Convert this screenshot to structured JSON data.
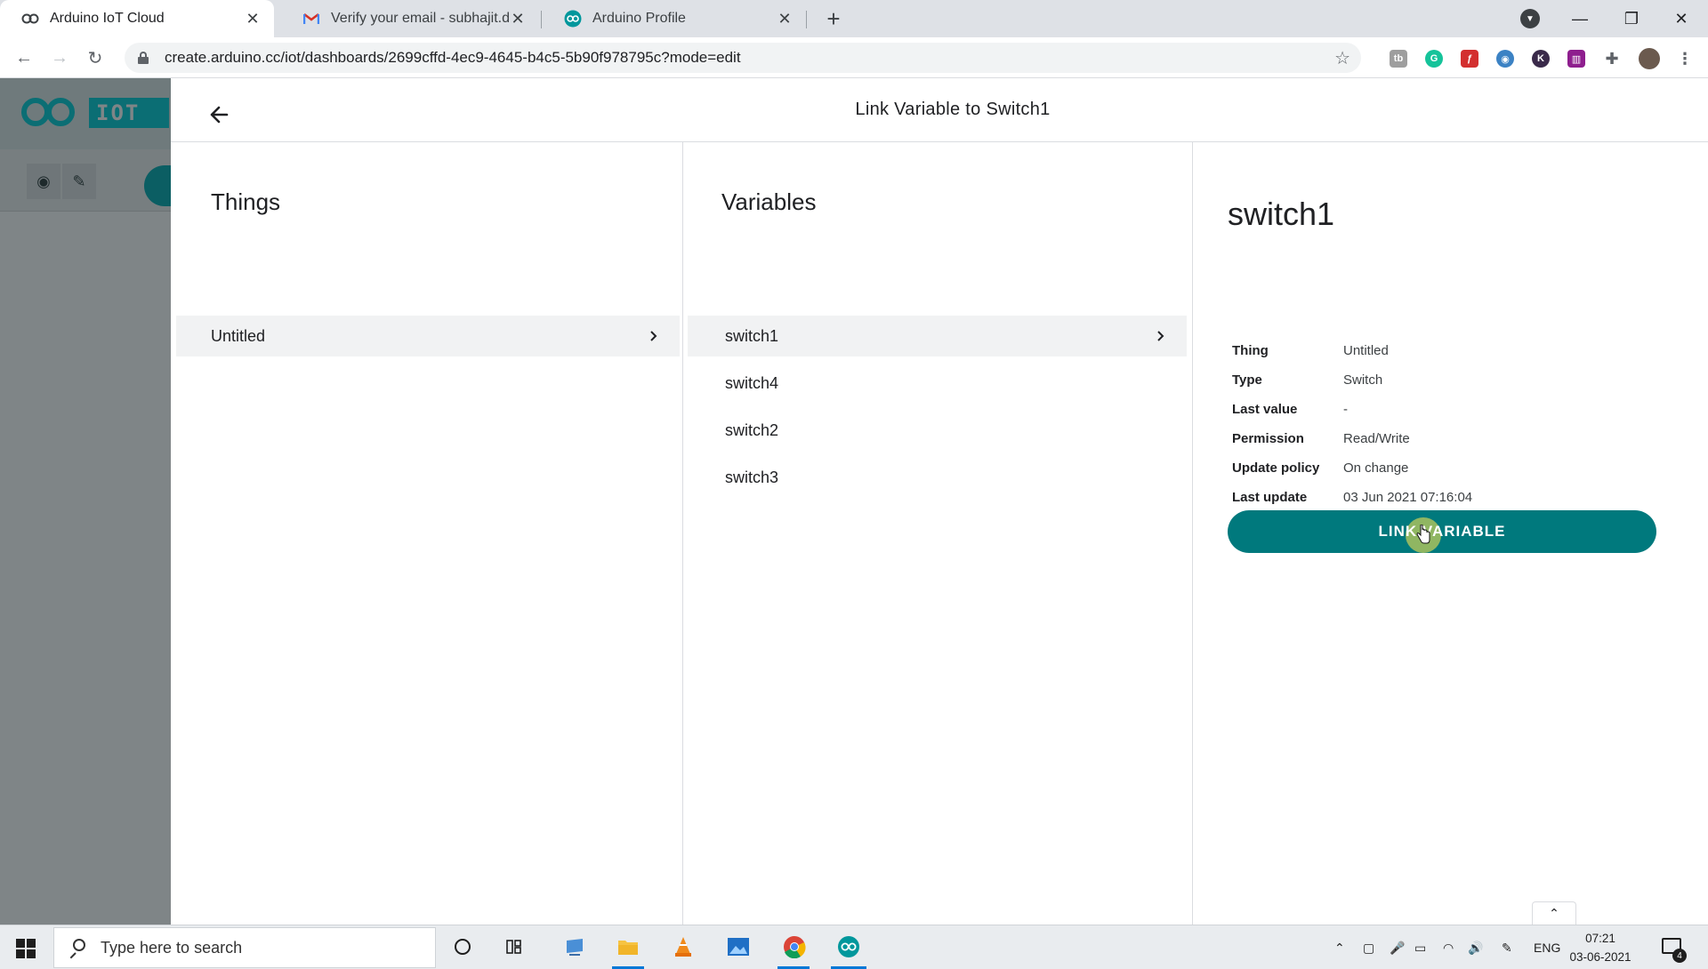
{
  "browser": {
    "tabs": [
      {
        "title": "Arduino IoT Cloud",
        "icon": "arduino-icon",
        "active": true
      },
      {
        "title": "Verify your email - subhajit.das.s",
        "icon": "gmail-icon",
        "active": false
      },
      {
        "title": "Arduino Profile",
        "icon": "arduino-icon",
        "active": false
      }
    ],
    "new_tab": "+",
    "url": "create.arduino.cc/iot/dashboards/2699cffd-4ec9-4645-b4c5-5b90f978795c?mode=edit"
  },
  "app": {
    "logo_text": "IOT C"
  },
  "modal": {
    "title": "Link Variable to Switch1",
    "things": {
      "heading": "Things",
      "items": [
        {
          "label": "Untitled",
          "selected": true
        }
      ]
    },
    "variables": {
      "heading": "Variables",
      "items": [
        {
          "label": "switch1",
          "selected": true
        },
        {
          "label": "switch4",
          "selected": false
        },
        {
          "label": "switch2",
          "selected": false
        },
        {
          "label": "switch3",
          "selected": false
        }
      ]
    },
    "details": {
      "name": "switch1",
      "rows": [
        {
          "key": "Thing",
          "value": "Untitled"
        },
        {
          "key": "Type",
          "value": "Switch"
        },
        {
          "key": "Last value",
          "value": "-"
        },
        {
          "key": "Permission",
          "value": "Read/Write"
        },
        {
          "key": "Update policy",
          "value": "On change"
        },
        {
          "key": "Last update",
          "value": "03 Jun 2021 07:16:04"
        }
      ],
      "link_button": "LINK VARIABLE"
    }
  },
  "taskbar": {
    "search_placeholder": "Type here to search",
    "language": "ENG",
    "time": "07:21",
    "date": "03-06-2021",
    "notification_count": "4"
  },
  "colors": {
    "accent": "#00797d",
    "backdrop": "#7f8587"
  }
}
